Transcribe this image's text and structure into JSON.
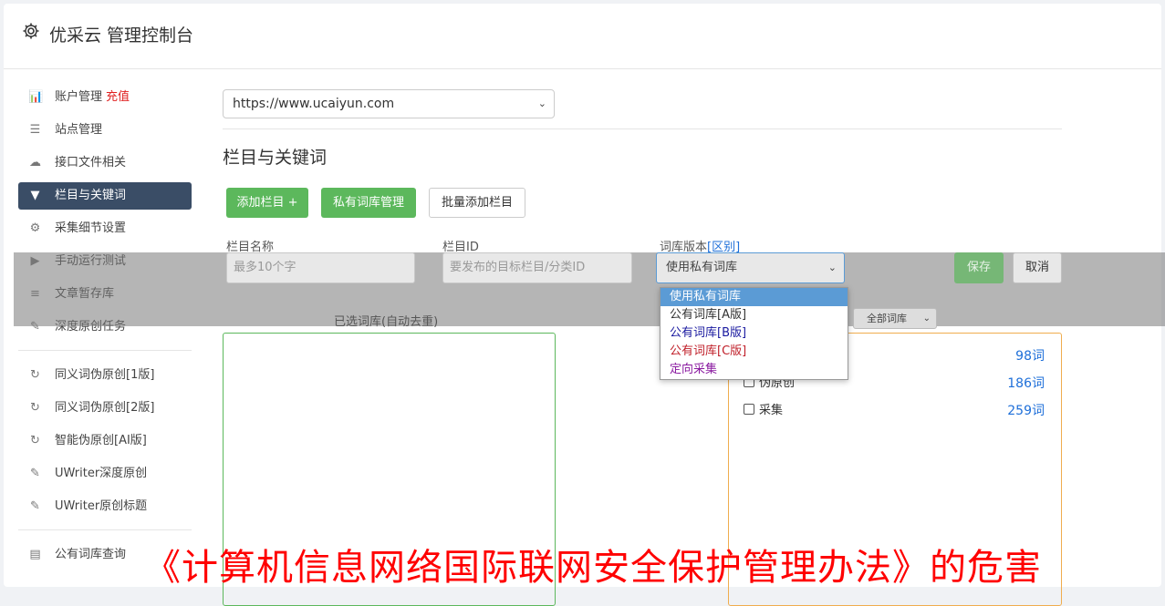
{
  "header": {
    "title": "优采云 管理控制台",
    "icon": "gear-icon"
  },
  "sidebar": {
    "items": [
      {
        "label": "账户管理",
        "extra": "充值",
        "icon": "bar-chart-icon",
        "glyph": "📊"
      },
      {
        "label": "站点管理",
        "icon": "server-icon",
        "glyph": "☰"
      },
      {
        "label": "接口文件相关",
        "icon": "cloud-upload-icon",
        "glyph": "☁"
      },
      {
        "label": "栏目与关键词",
        "icon": "filter-icon",
        "glyph": "▼",
        "active": true
      },
      {
        "label": "采集细节设置",
        "icon": "cogs-icon",
        "glyph": "⚙"
      },
      {
        "label": "手动运行测试",
        "icon": "play-circle-icon",
        "glyph": "▶"
      },
      {
        "label": "文章暂存库",
        "icon": "database-icon",
        "glyph": "≡"
      },
      {
        "label": "深度原创任务",
        "icon": "edit-icon",
        "glyph": "✎"
      }
    ],
    "items2": [
      {
        "label": "同义词伪原创[1版]",
        "icon": "refresh-icon",
        "glyph": "↻"
      },
      {
        "label": "同义词伪原创[2版]",
        "icon": "refresh-icon",
        "glyph": "↻"
      },
      {
        "label": "智能伪原创[AI版]",
        "icon": "refresh-icon",
        "glyph": "↻"
      },
      {
        "label": "UWriter深度原创",
        "icon": "edit-icon",
        "glyph": "✎"
      },
      {
        "label": "UWriter原创标题",
        "icon": "edit-icon",
        "glyph": "✎"
      }
    ],
    "items3": [
      {
        "label": "公有词库查询",
        "icon": "book-icon",
        "glyph": "▤"
      }
    ]
  },
  "main": {
    "site_select": "https://www.ucaiyun.com",
    "section_title": "栏目与关键词",
    "buttons": {
      "add_column": "添加栏目 +",
      "private_lib": "私有词库管理",
      "batch_add": "批量添加栏目"
    },
    "form": {
      "name_label": "栏目名称",
      "name_placeholder": "最多10个字",
      "id_label": "栏目ID",
      "id_placeholder": "要发布的目标栏目/分类ID",
      "lib_label": "词库版本",
      "lib_diff_link": "[区别]",
      "lib_value": "使用私有词库",
      "save": "保存",
      "cancel": "取消"
    },
    "selected_label": "已选词库(自动去重)",
    "all_lib_select": "全部词库",
    "lib_rows": [
      {
        "label": "",
        "count": "98词"
      },
      {
        "label": "伪原创",
        "count": "186词"
      },
      {
        "label": "采集",
        "count": "259词"
      }
    ],
    "dropdown": {
      "options": [
        {
          "label": "使用私有词库",
          "color": "#ffffff",
          "selected": true
        },
        {
          "label": "公有词库[A版]",
          "color": "#333333"
        },
        {
          "label": "公有词库[B版]",
          "color": "#1a1aa0"
        },
        {
          "label": "公有词库[C版]",
          "color": "#c0202a"
        },
        {
          "label": "定向采集",
          "color": "#8a1aa0"
        }
      ]
    }
  },
  "watermark": "《计算机信息网络国际联网安全保护管理办法》的危害",
  "colors": {
    "accent_green": "#5cb85c",
    "sidebar_active": "#3a4d66",
    "link_blue": "#1e6fd9",
    "recharge_red": "#e02020"
  }
}
